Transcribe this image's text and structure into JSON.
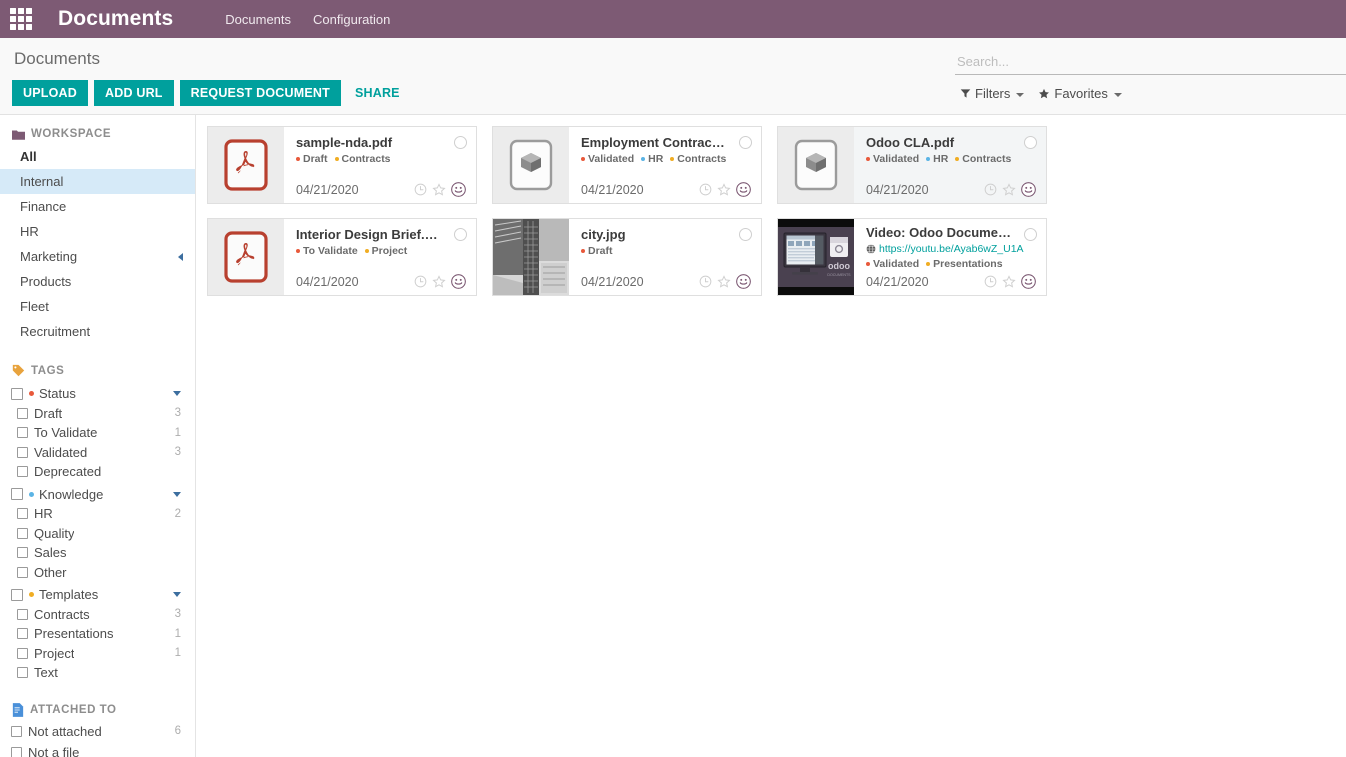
{
  "navbar": {
    "apps_icon": "apps-grid-icon",
    "brand": "Documents",
    "menu": [
      {
        "label": "Documents"
      },
      {
        "label": "Configuration"
      }
    ]
  },
  "control_panel": {
    "title": "Documents",
    "buttons": [
      {
        "label": "UPLOAD",
        "style": "primary"
      },
      {
        "label": "ADD URL",
        "style": "primary"
      },
      {
        "label": "REQUEST DOCUMENT",
        "style": "primary"
      },
      {
        "label": "SHARE",
        "style": "link"
      }
    ],
    "search": {
      "placeholder": "Search...",
      "value": ""
    },
    "filters_label": "Filters",
    "favorites_label": "Favorites"
  },
  "sidebar": {
    "workspace": {
      "heading": "WORKSPACE",
      "items": [
        {
          "label": "All",
          "active": false,
          "bold": true,
          "caret": false
        },
        {
          "label": "Internal",
          "active": true,
          "bold": false,
          "caret": false
        },
        {
          "label": "Finance",
          "active": false,
          "bold": false,
          "caret": false
        },
        {
          "label": "HR",
          "active": false,
          "bold": false,
          "caret": false
        },
        {
          "label": "Marketing",
          "active": false,
          "bold": false,
          "caret": true
        },
        {
          "label": "Products",
          "active": false,
          "bold": false,
          "caret": false
        },
        {
          "label": "Fleet",
          "active": false,
          "bold": false,
          "caret": false
        },
        {
          "label": "Recruitment",
          "active": false,
          "bold": false,
          "caret": false
        }
      ]
    },
    "tags": {
      "heading": "TAGS",
      "groups": [
        {
          "label": "Status",
          "color": "#e8593b",
          "expanded": true,
          "children": [
            {
              "label": "Draft",
              "count": "3"
            },
            {
              "label": "To Validate",
              "count": "1"
            },
            {
              "label": "Validated",
              "count": "3"
            },
            {
              "label": "Deprecated",
              "count": ""
            }
          ]
        },
        {
          "label": "Knowledge",
          "color": "#5bb4e5",
          "expanded": true,
          "children": [
            {
              "label": "HR",
              "count": "2"
            },
            {
              "label": "Quality",
              "count": ""
            },
            {
              "label": "Sales",
              "count": ""
            },
            {
              "label": "Other",
              "count": ""
            }
          ]
        },
        {
          "label": "Templates",
          "color": "#f0ad23",
          "expanded": true,
          "children": [
            {
              "label": "Contracts",
              "count": "3"
            },
            {
              "label": "Presentations",
              "count": "1"
            },
            {
              "label": "Project",
              "count": "1"
            },
            {
              "label": "Text",
              "count": ""
            }
          ]
        }
      ]
    },
    "attached_to": {
      "heading": "ATTACHED TO",
      "items": [
        {
          "label": "Not attached",
          "count": "6"
        },
        {
          "label": "Not a file",
          "count": ""
        }
      ]
    }
  },
  "kanban": {
    "cards": [
      {
        "name": "sample-nda.pdf",
        "thumb": "pdf-file-icon",
        "url": "",
        "tags": [
          {
            "label": "Draft",
            "color": "#e8593b"
          },
          {
            "label": "Contracts",
            "color": "#f0ad23"
          }
        ],
        "date": "04/21/2020",
        "selected": false
      },
      {
        "name": "Employment Contract.pdf",
        "thumb": "box-file-icon",
        "url": "",
        "tags": [
          {
            "label": "Validated",
            "color": "#e8593b"
          },
          {
            "label": "HR",
            "color": "#5bb4e5"
          },
          {
            "label": "Contracts",
            "color": "#f0ad23"
          }
        ],
        "date": "04/21/2020",
        "selected": false
      },
      {
        "name": "Odoo CLA.pdf",
        "thumb": "box-file-icon",
        "url": "",
        "tags": [
          {
            "label": "Validated",
            "color": "#e8593b"
          },
          {
            "label": "HR",
            "color": "#5bb4e5"
          },
          {
            "label": "Contracts",
            "color": "#f0ad23"
          }
        ],
        "date": "04/21/2020",
        "selected": true
      },
      {
        "name": "Interior Design Brief.pdf",
        "thumb": "pdf-file-icon",
        "url": "",
        "tags": [
          {
            "label": "To Validate",
            "color": "#e8593b"
          },
          {
            "label": "Project",
            "color": "#f0ad23"
          }
        ],
        "date": "04/21/2020",
        "selected": false
      },
      {
        "name": "city.jpg",
        "thumb": "image-thumbnail",
        "url": "",
        "tags": [
          {
            "label": "Draft",
            "color": "#e8593b"
          }
        ],
        "date": "04/21/2020",
        "selected": false
      },
      {
        "name": "Video: Odoo Documents",
        "thumb": "video-thumbnail",
        "url": "https://youtu.be/Ayab6wZ_U1A",
        "tags": [
          {
            "label": "Validated",
            "color": "#e8593b"
          },
          {
            "label": "Presentations",
            "color": "#f0ad23"
          }
        ],
        "date": "04/21/2020",
        "selected": false
      }
    ],
    "card_action_icons": [
      "clock-icon",
      "star-icon",
      "avatar-smiley-icon"
    ]
  },
  "colors": {
    "brand_purple": "#7d5a74",
    "teal": "#00a09d",
    "active_blue": "#d6eaf8",
    "status_red": "#e8593b",
    "knowledge_blue": "#5bb4e5",
    "templates_yellow": "#f0ad23"
  }
}
